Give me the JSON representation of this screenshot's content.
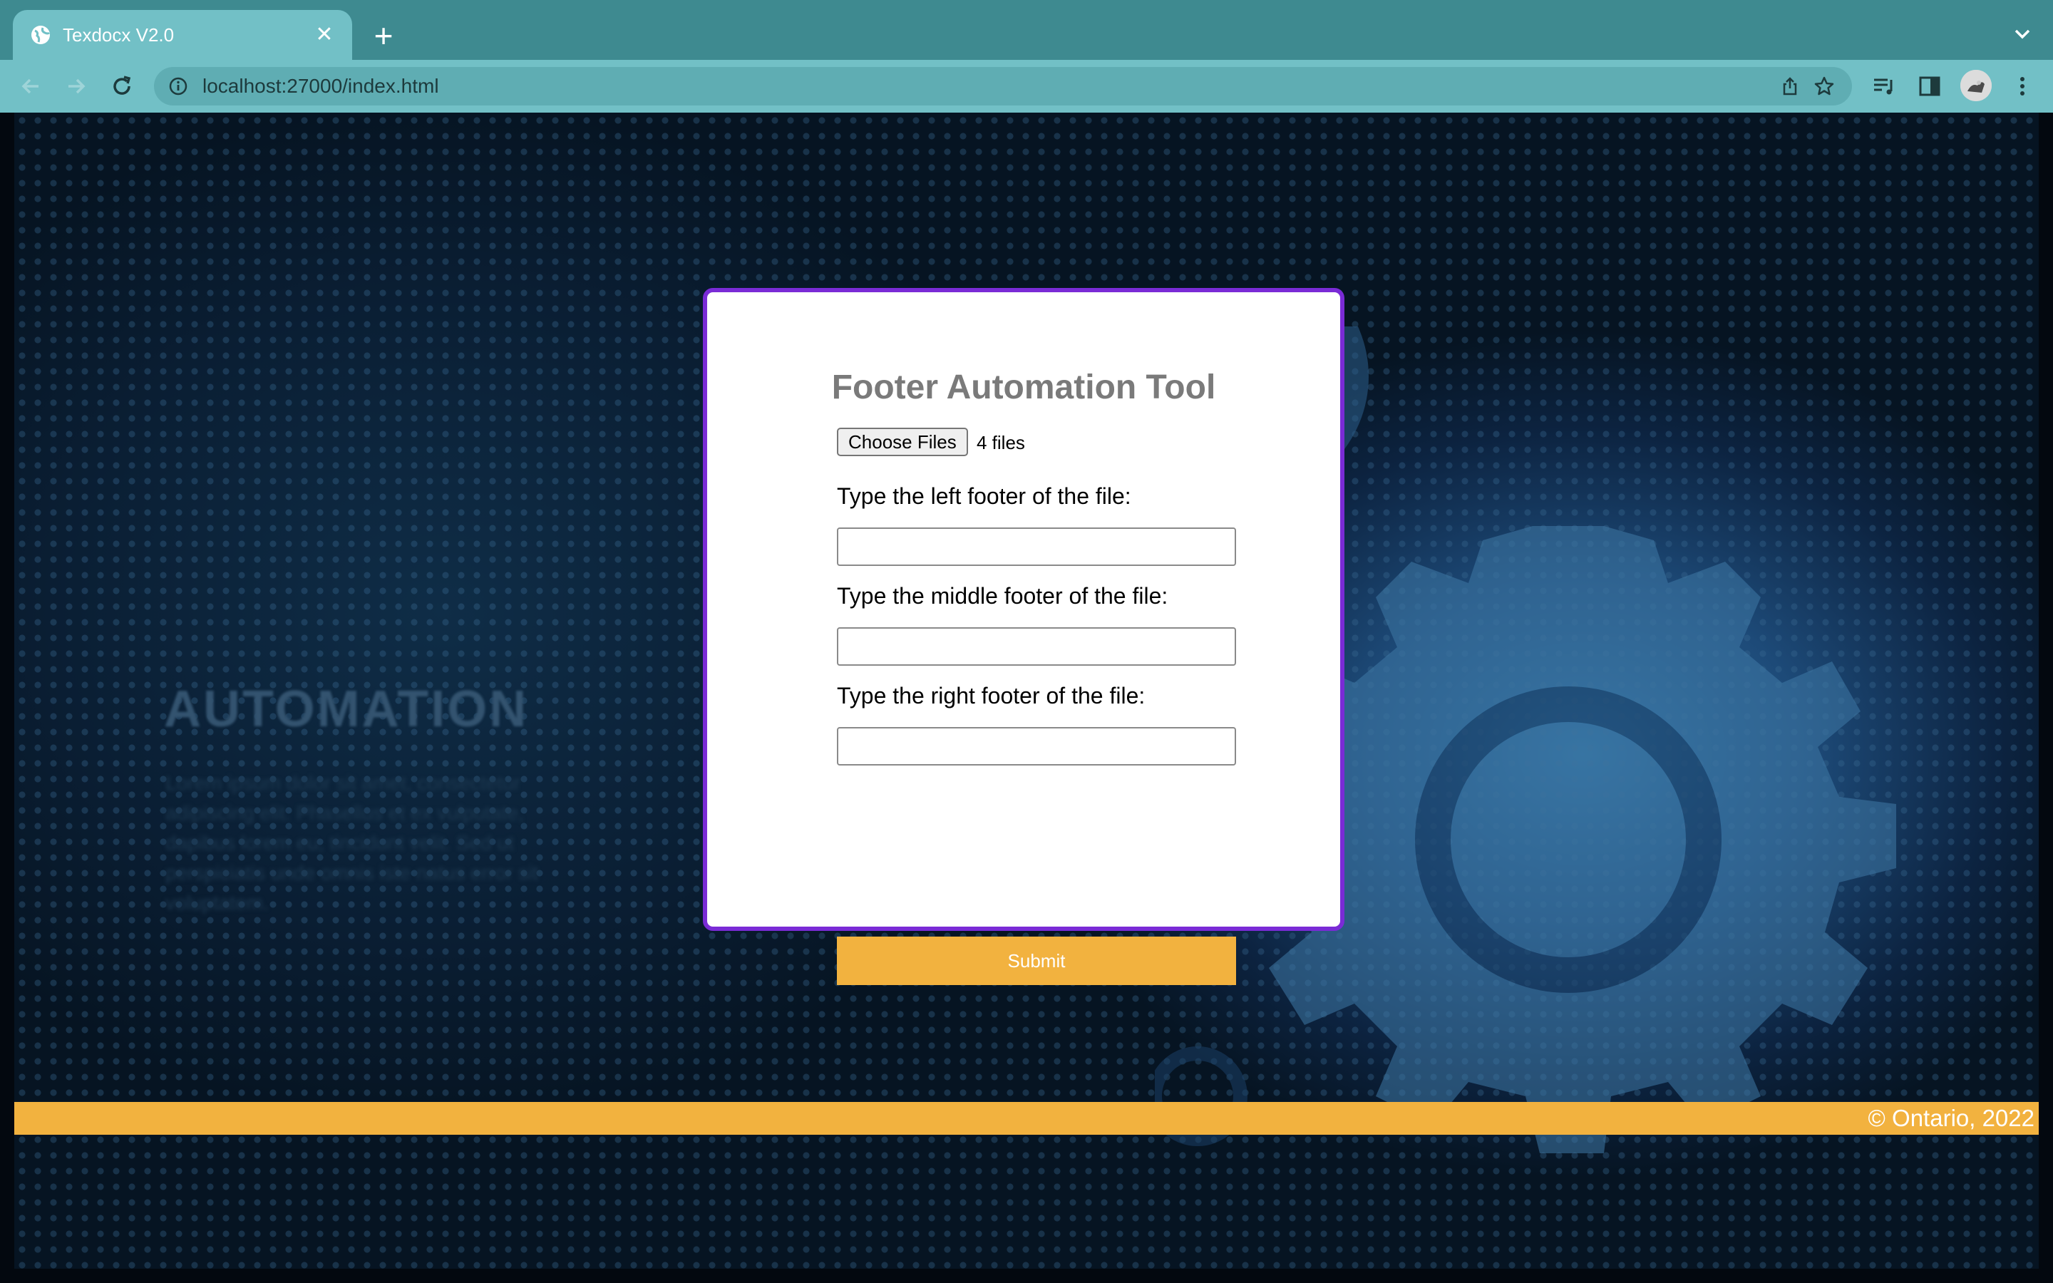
{
  "browser": {
    "tab_title": "Texdocx V2.0",
    "url": "localhost:27000/index.html",
    "icons": [
      "globe-icon",
      "close-icon",
      "plus-icon",
      "chevron-down-icon",
      "back-arrow-icon",
      "forward-arrow-icon",
      "reload-icon",
      "info-icon",
      "share-icon",
      "star-icon",
      "media-controls-icon",
      "side-panel-icon",
      "profile-avatar",
      "kebab-menu-icon"
    ]
  },
  "hero": {
    "heading": "AUTOMATION",
    "lorem": "Lorem ipsum dolor sit amet, consectetur adipiscing elit. Phasellus et ex vulputate, dapibus lorem eu, tincidunt velit. Sed ut perspiciatis unde omnis iste natus error sit voluptatem."
  },
  "form": {
    "title": "Footer Automation Tool",
    "file_button": "Choose Files",
    "file_count": "4 files",
    "left_label": "Type the left footer of the file:",
    "middle_label": "Type the middle footer of the file:",
    "right_label": "Type the right footer of the file:",
    "left_value": "",
    "middle_value": "",
    "right_value": "",
    "submit_label": "Submit"
  },
  "footer": {
    "text": "© Ontario, 2022"
  },
  "colors": {
    "accent": "#f2b23f",
    "card_border": "#7a2bd6",
    "chrome_dark": "#3e8a90",
    "chrome_light": "#72c0c6"
  }
}
